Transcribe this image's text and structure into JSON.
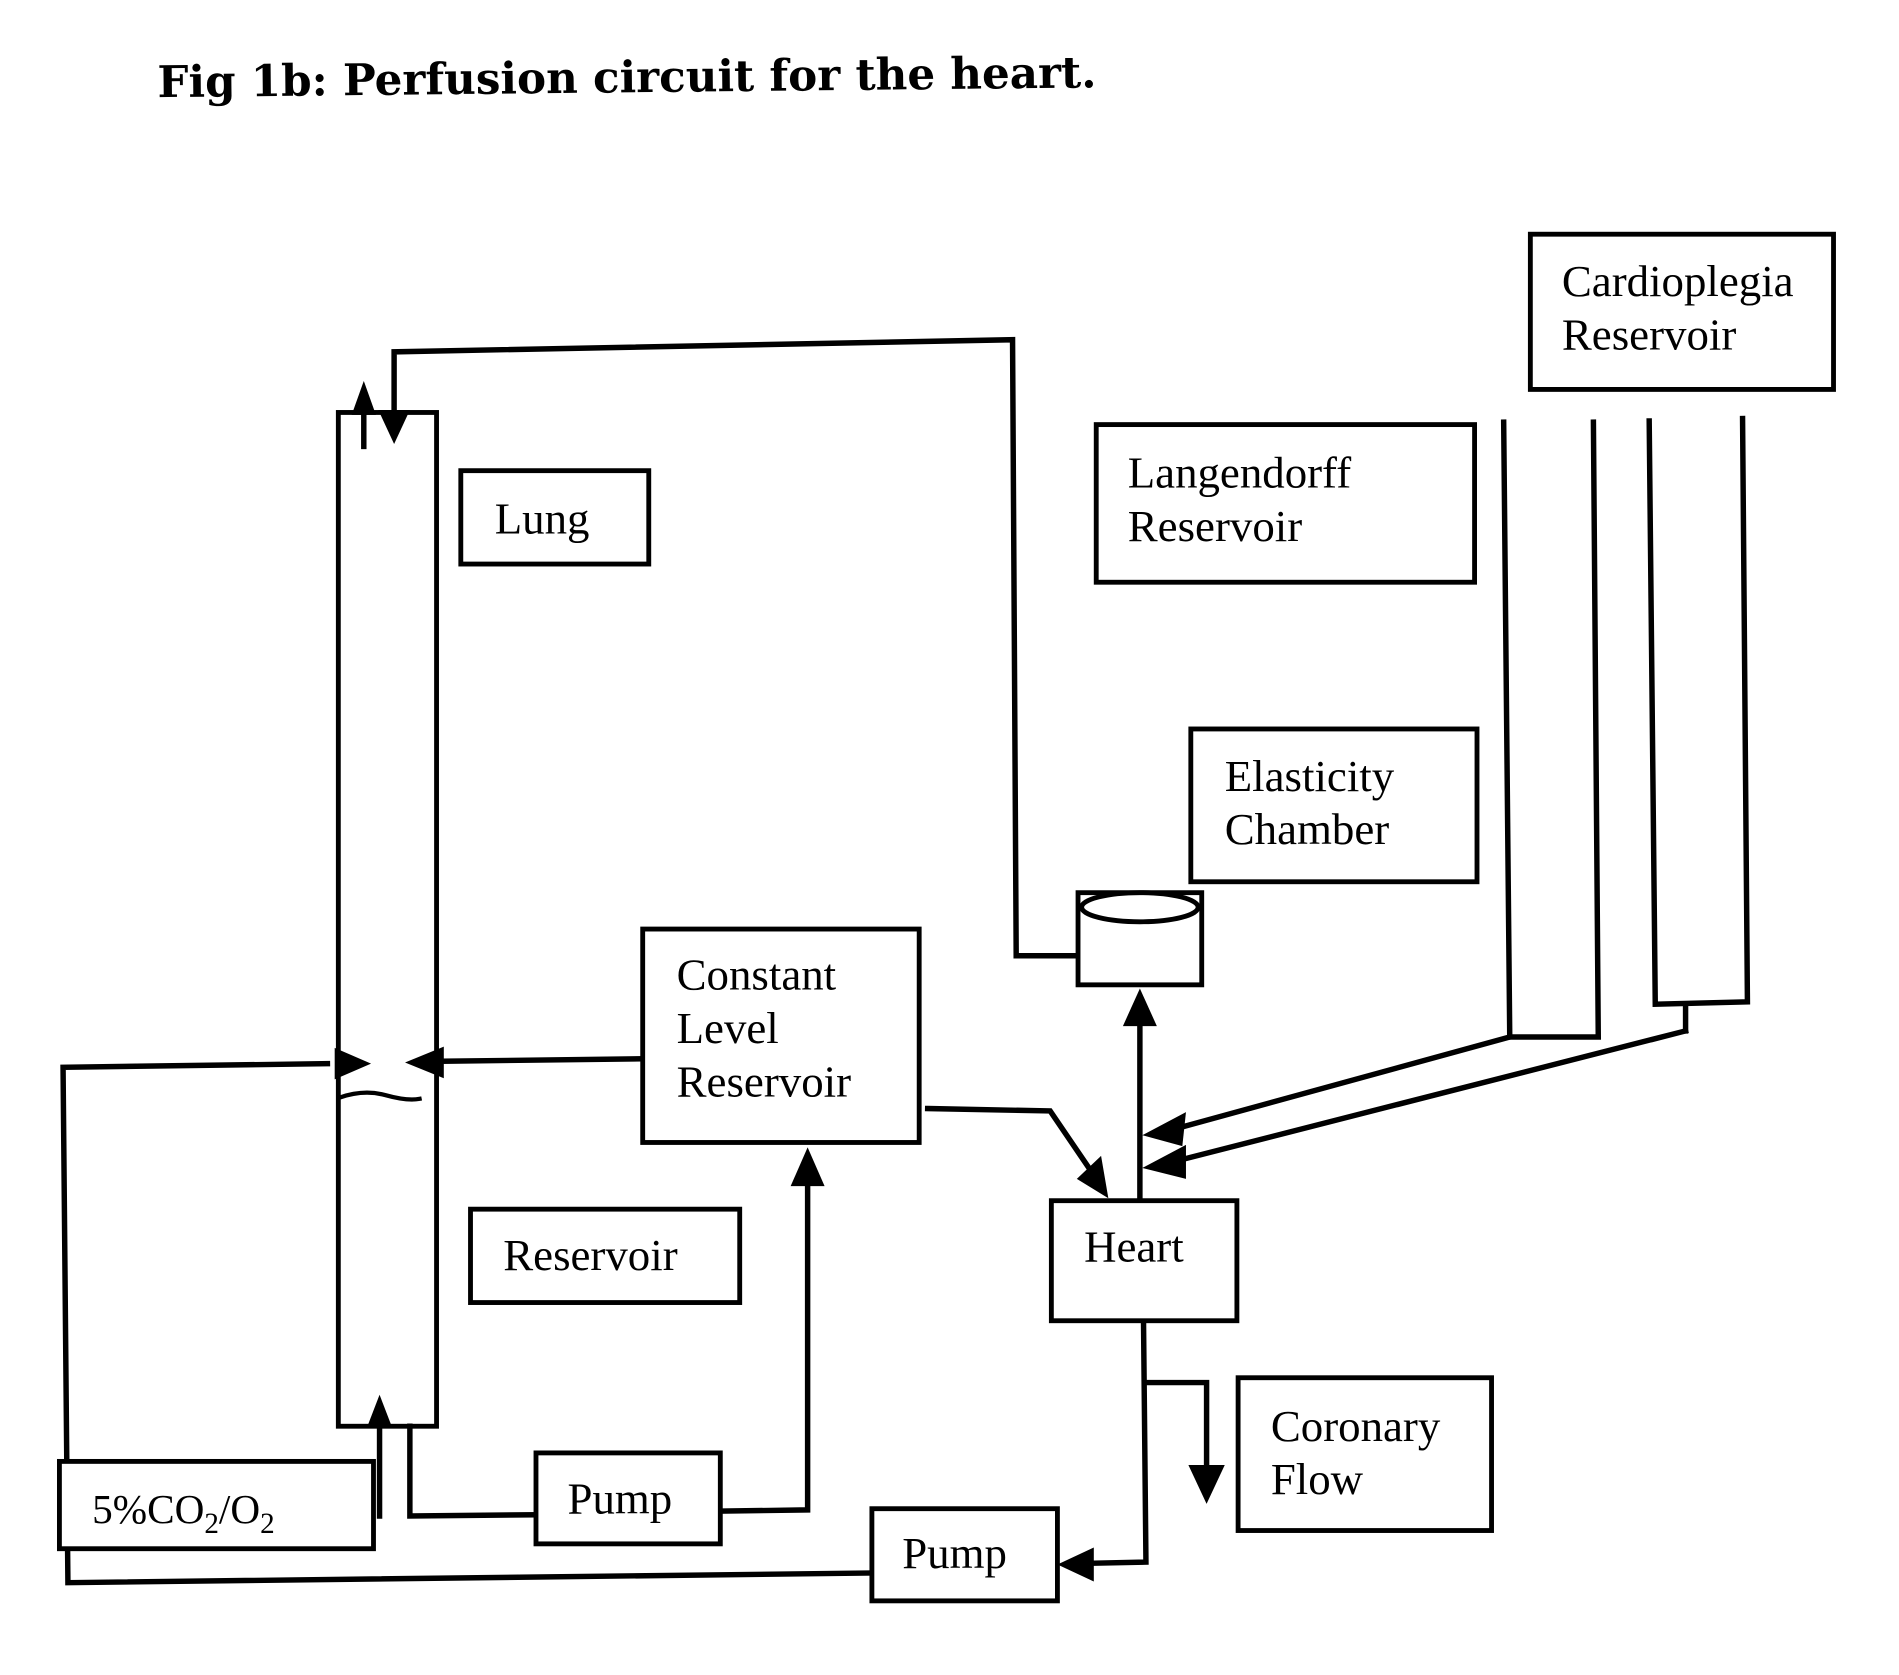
{
  "title": "Fig 1b: Perfusion circuit for the heart.",
  "components": {
    "lung": {
      "label": "Lung"
    },
    "langendorff_reservoir": {
      "line1": "Langendorff",
      "line2": "Reservoir"
    },
    "cardioplegia_reservoir": {
      "line1": "Cardioplegia",
      "line2": "Reservoir"
    },
    "elasticity_chamber": {
      "line1": "Elasticity",
      "line2": "Chamber"
    },
    "constant_level_reservoir": {
      "line1": "Constant",
      "line2": "Level",
      "line3": "Reservoir"
    },
    "reservoir": {
      "label": "Reservoir"
    },
    "heart": {
      "label": "Heart"
    },
    "coronary_flow": {
      "line1": "Coronary",
      "line2": "Flow"
    },
    "pump_1": {
      "label": "Pump"
    },
    "pump_2": {
      "label": "Pump"
    },
    "gas": {
      "prefix": "5%CO",
      "sub1": "2",
      "mid": "/O",
      "sub2": "2"
    }
  }
}
